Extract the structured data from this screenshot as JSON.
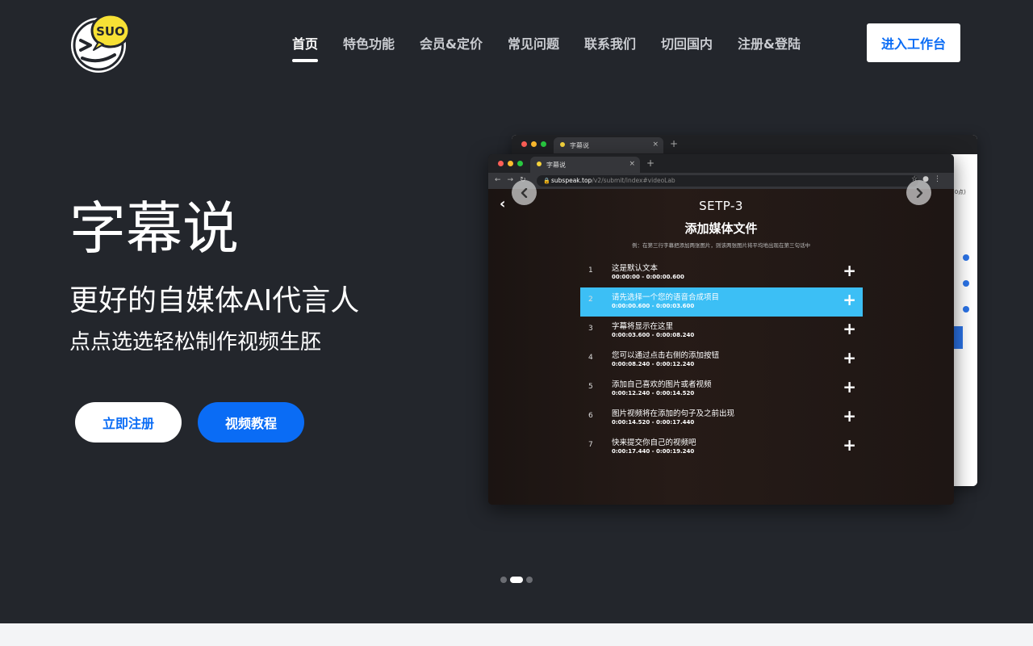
{
  "logo": {
    "text": "SUO",
    "icon": "winking-face-logo"
  },
  "nav": {
    "items": [
      {
        "label": "首页",
        "active": true
      },
      {
        "label": "特色功能"
      },
      {
        "label": "会员&定价"
      },
      {
        "label": "常见问题"
      },
      {
        "label": "联系我们"
      },
      {
        "label": "切回国内"
      },
      {
        "label": "注册&登陆"
      }
    ],
    "workbench_label": "进入工作台"
  },
  "hero": {
    "title": "字幕说",
    "subtitle": "更好的自媒体AI代言人",
    "tagline": "点点选选轻松制作视频生胚",
    "register_label": "立即注册",
    "video_label": "视频教程"
  },
  "mockup": {
    "tab_title": "字幕说",
    "back_tab_title": "字幕说",
    "url_host": "subspeak.top",
    "url_path": "/v2/submit/index#videoLab",
    "back_side_text": "段(0点)",
    "step_label": "SETP-3",
    "step_title": "添加媒体文件",
    "step_tip": "例：在第三行字幕把添加两张图片，则该两张图片将平均地出现在第三句话中",
    "subtitles": [
      {
        "idx": "1",
        "text": "这是默认文本",
        "time": "00:00:00 - 0:00:00.600"
      },
      {
        "idx": "2",
        "text": "请先选择一个您的语音合成项目",
        "time": "0:00:00.600 - 0:00:03.600",
        "highlight": true
      },
      {
        "idx": "3",
        "text": "字幕将显示在这里",
        "time": "0:00:03.600 - 0:00:08.240"
      },
      {
        "idx": "4",
        "text": "您可以通过点击右侧的添加按钮",
        "time": "0:00:08.240 - 0:00:12.240"
      },
      {
        "idx": "5",
        "text": "添加自己喜欢的图片或者视频",
        "time": "0:00:12.240 - 0:00:14.520"
      },
      {
        "idx": "6",
        "text": "图片视频将在添加的句子及之前出现",
        "time": "0:00:14.520 - 0:00:17.440"
      },
      {
        "idx": "7",
        "text": "快来提交你自己的视频吧",
        "time": "0:00:17.440 - 0:00:19.240"
      }
    ],
    "inner_dots_active": 3,
    "inner_dots_count": 4
  },
  "carousel": {
    "active_index": 2,
    "count": 3
  },
  "colors": {
    "background": "#23262c",
    "accent": "#0a6cf5",
    "highlight": "#3cbff5"
  }
}
